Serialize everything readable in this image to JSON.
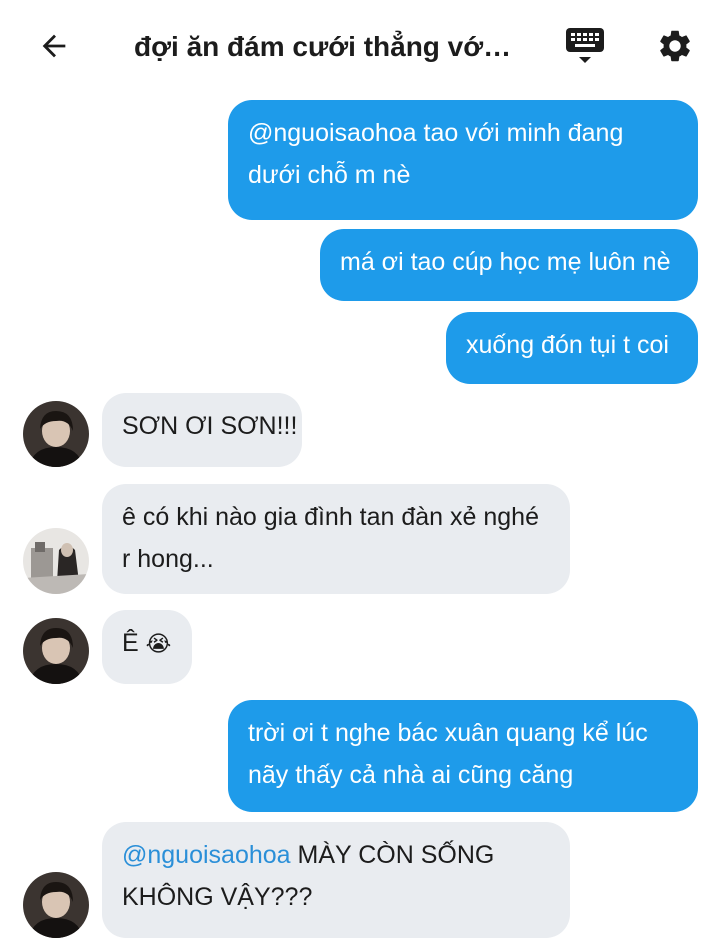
{
  "header": {
    "title": "đợi ăn đám cưới thẳng với…",
    "back_icon": "arrow-left-icon",
    "keyboard_icon": "keyboard-icon",
    "settings_icon": "gear-icon"
  },
  "messages": [
    {
      "dir": "out",
      "text": "@nguoisaohoa tao với minh đang dưới chỗ m nè"
    },
    {
      "dir": "out",
      "text": "má ơi tao cúp học mẹ luôn nè"
    },
    {
      "dir": "out",
      "text": "xuống đón tụi t coi"
    },
    {
      "dir": "in",
      "text": "SƠN ƠI SƠN!!!"
    },
    {
      "dir": "in",
      "text": "ê có khi nào gia đình tan đàn xẻ nghé r hong..."
    },
    {
      "dir": "in",
      "text": "Ê",
      "emoji": "😭"
    },
    {
      "dir": "out",
      "text": "trời ơi t nghe bác xuân quang kể lúc nãy thấy cả nhà ai cũng căng"
    },
    {
      "dir": "in",
      "mention": "@nguoisaohoa",
      "text": " MÀY CÒN SỐNG KHÔNG VẬY???"
    }
  ],
  "colors": {
    "outgoing": "#1e9bea",
    "incoming": "#e9ecf0",
    "mention": "#2a8fd8"
  }
}
